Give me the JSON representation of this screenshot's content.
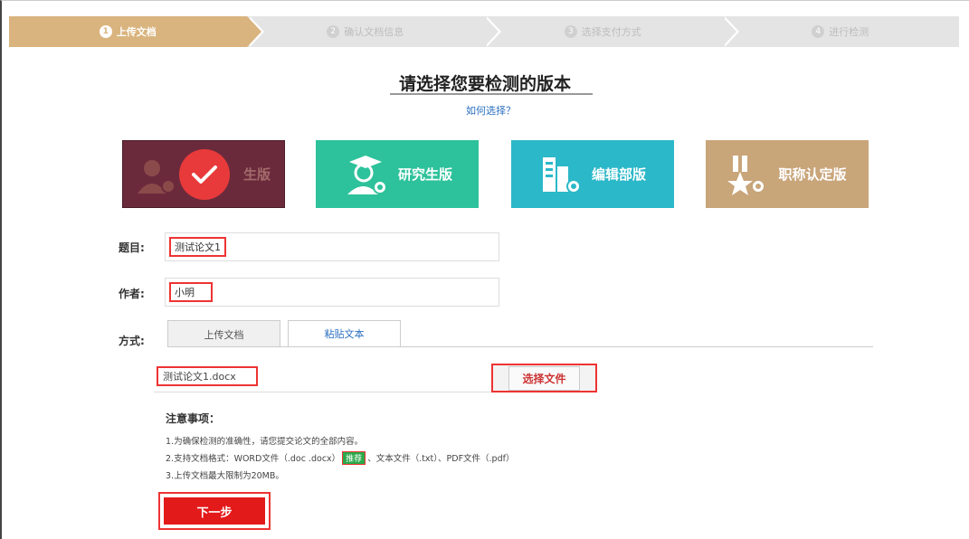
{
  "steps": [
    {
      "num": "1",
      "label": "上传文档"
    },
    {
      "num": "2",
      "label": "确认文档信息"
    },
    {
      "num": "3",
      "label": "选择支付方式"
    },
    {
      "num": "4",
      "label": "进行检测"
    }
  ],
  "header": {
    "title": "请选择您要检测的版本",
    "help_link": "如何选择？"
  },
  "versions": [
    {
      "label": "学生版",
      "visible_label": "生版",
      "selected": true,
      "icon": "student-icon",
      "color": "#6b2a3c"
    },
    {
      "label": "研究生版",
      "icon": "graduate-icon",
      "color": "#2dc29b"
    },
    {
      "label": "编辑部版",
      "icon": "building-icon",
      "color": "#2bb8c9"
    },
    {
      "label": "职称认定版",
      "icon": "medal-icon",
      "color": "#c9a57a"
    }
  ],
  "form": {
    "title_label": "题目:",
    "title_value": "测试论文1",
    "author_label": "作者:",
    "author_value": "小明",
    "method_label": "方式:",
    "tab_upload": "上传文档",
    "tab_paste": "粘贴文本",
    "file_name": "测试论文1.docx",
    "choose_button": "选择文件"
  },
  "notes": {
    "title": "注意事项：",
    "line1": "1.为确保检测的准确性，请您提交论文的全部内容。",
    "line2_before": "2.支持文档格式：WORD文件（.doc .docx）",
    "line2_tag": "推荐",
    "line2_after": "、文本文件（.txt）、PDF文件（.pdf）",
    "line3": "3.上传文档最大限制为20MB。"
  },
  "next_button": "下一步",
  "colors": {
    "accent_red": "#e31a1a",
    "step_active": "#d9b47e"
  }
}
